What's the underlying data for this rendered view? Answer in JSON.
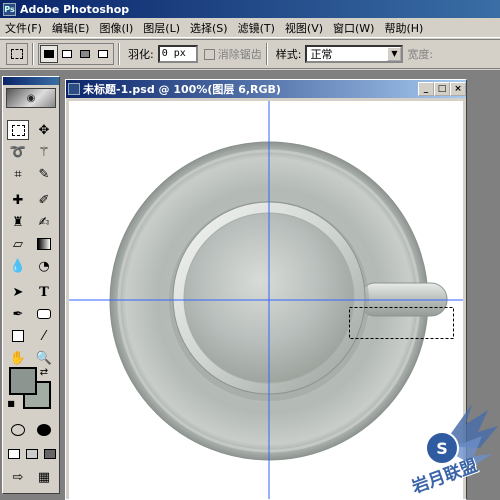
{
  "app": {
    "title": "Adobe Photoshop"
  },
  "menu": [
    "文件(F)",
    "编辑(E)",
    "图像(I)",
    "图层(L)",
    "选择(S)",
    "滤镜(T)",
    "视图(V)",
    "窗口(W)",
    "帮助(H)"
  ],
  "options": {
    "feather_label": "羽化:",
    "feather_value": "0 px",
    "antialias_label": "消除锯齿",
    "style_label": "样式:",
    "style_value": "正常",
    "width_label": "宽度:"
  },
  "document": {
    "title": "未标题-1.psd @ 100%(图层 6,RGB)"
  },
  "colors": {
    "foreground": "#8c9590",
    "background": "#a3aba5",
    "guide": "#3366ff"
  },
  "watermark": {
    "text": "岩月联盟"
  },
  "tools": [
    "marquee-tool-icon",
    "move-tool-icon",
    "lasso-tool-icon",
    "magic-wand-icon",
    "crop-tool-icon",
    "slice-tool-icon",
    "healing-brush-icon",
    "brush-tool-icon",
    "clone-stamp-icon",
    "history-brush-icon",
    "eraser-icon",
    "gradient-tool-icon",
    "blur-tool-icon",
    "dodge-tool-icon",
    "path-select-icon",
    "type-tool-icon",
    "pen-tool-icon",
    "shape-tool-icon",
    "notes-tool-icon",
    "eyedropper-icon",
    "hand-tool-icon",
    "zoom-tool-icon"
  ]
}
